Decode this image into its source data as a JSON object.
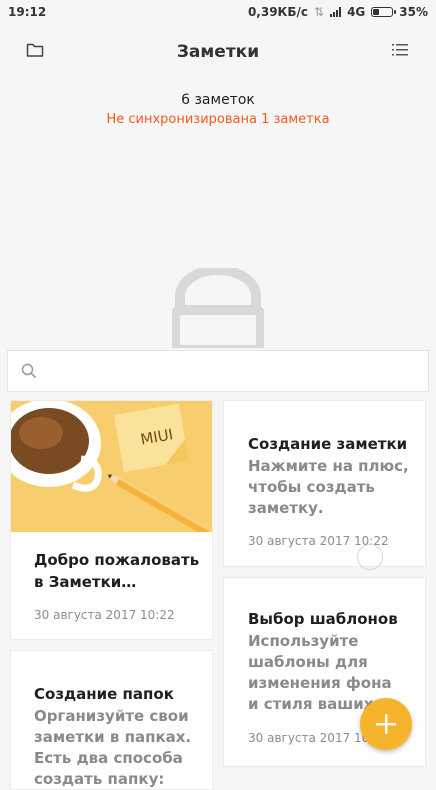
{
  "status_bar": {
    "time": "19:12",
    "speed": "0,39КБ/с",
    "network": "4G",
    "battery_text": "35%",
    "battery_level": 0.35
  },
  "header": {
    "title": "Заметки",
    "left_icon": "folder-icon",
    "right_icon": "list-icon"
  },
  "summary": {
    "count": "6 заметок",
    "sync_status": "Не синхронизирована 1 заметка",
    "sync_color": "#f05a24"
  },
  "search": {
    "placeholder": ""
  },
  "notes": [
    {
      "title": "Добро пожаловать в Заметки…",
      "body": "",
      "date": "30 августа 2017 10:22",
      "image_label": "MIUI"
    },
    {
      "title": "Создание заметки",
      "body": "Нажмите на плюс, чтобы создать заметку.",
      "date": "30 августа 2017 10:22"
    },
    {
      "title": "Выбор шаблонов",
      "body_lines": [
        "Используйте",
        "шаблоны для",
        "изменения фона",
        "и стиля ваших за"
      ],
      "date": "30 августа 2017 10:"
    },
    {
      "title": "Создание папок",
      "body_lines": [
        "Организуйте свои",
        "заметки в папках.",
        "Есть два способа",
        "создать папку:"
      ]
    }
  ],
  "fab": {
    "icon": "plus-icon",
    "color": "#f6b32c"
  }
}
